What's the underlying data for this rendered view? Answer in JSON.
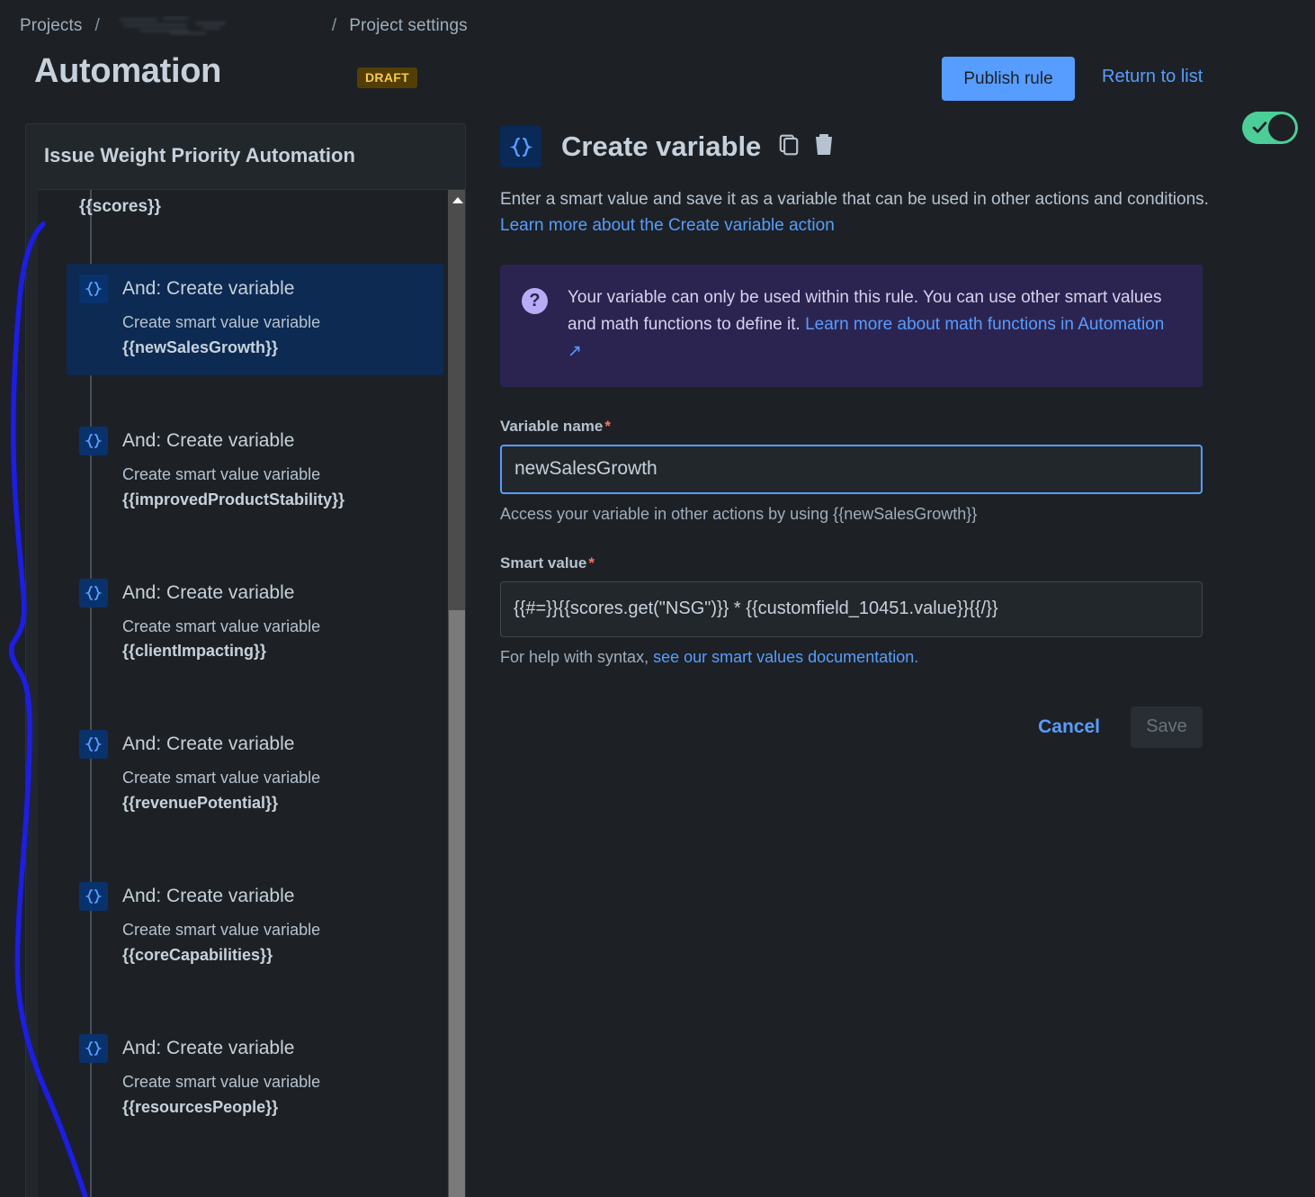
{
  "breadcrumb": {
    "projects_label": "Projects",
    "separator": "/",
    "project_name_redacted": "",
    "settings_label": "Project settings"
  },
  "header": {
    "title": "Automation",
    "status_badge": "DRAFT",
    "publish_label": "Publish rule",
    "return_label": "Return to list",
    "toggle_state": "on",
    "accent_blue": "#579dff",
    "toggle_green": "#4bce97",
    "draft_bg": "#533f04",
    "draft_text": "#f5cd47"
  },
  "rule_panel": {
    "title": "Issue Weight Priority Automation",
    "partial_top_item": "{{scores}}",
    "items": [
      {
        "title": "And: Create variable",
        "description": "Create smart value variable",
        "variable": "{{newSalesGrowth}}",
        "icon": "curly-braces-icon",
        "selected": true
      },
      {
        "title": "And: Create variable",
        "description": "Create smart value variable",
        "variable": "{{improvedProductStability}}",
        "icon": "curly-braces-icon",
        "selected": false
      },
      {
        "title": "And: Create variable",
        "description": "Create smart value variable",
        "variable": "{{clientImpacting}}",
        "icon": "curly-braces-icon",
        "selected": false
      },
      {
        "title": "And: Create variable",
        "description": "Create smart value variable",
        "variable": "{{revenuePotential}}",
        "icon": "curly-braces-icon",
        "selected": false
      },
      {
        "title": "And: Create variable",
        "description": "Create smart value variable",
        "variable": "{{coreCapabilities}}",
        "icon": "curly-braces-icon",
        "selected": false
      },
      {
        "title": "And: Create variable",
        "description": "Create smart value variable",
        "variable": "{{resourcesPeople}}",
        "icon": "curly-braces-icon",
        "selected": false
      }
    ]
  },
  "detail": {
    "icon": "curly-braces-icon",
    "title": "Create variable",
    "copy_icon": "copy-icon",
    "delete_icon": "trash-icon",
    "description_text": "Enter a smart value and save it as a variable that can be used in other actions and conditions. ",
    "description_link": "Learn more about the Create variable action",
    "info": {
      "icon": "question-mark-icon",
      "text": "Your variable can only be used within this rule. You can use other smart values and math functions to define it. ",
      "link": "Learn more about math functions in Automation",
      "link_suffix": "↗"
    },
    "variable_name": {
      "label": "Variable name",
      "required_mark": "*",
      "value": "newSalesGrowth",
      "placeholder": "",
      "helper": "Access your variable in other actions by using {{newSalesGrowth}}"
    },
    "smart_value": {
      "label": "Smart value",
      "required_mark": "*",
      "value": "{{#=}}{{scores.get(\"NSG\")}} * {{customfield_10451.value}}{{/}}",
      "placeholder": "",
      "helper_prefix": "For help with syntax, ",
      "helper_link": "see our smart values documentation."
    },
    "cancel_label": "Cancel",
    "save_label": "Save",
    "save_disabled": true
  },
  "annotation": {
    "name": "blue-ink-curve",
    "color": "#1c1cee"
  }
}
